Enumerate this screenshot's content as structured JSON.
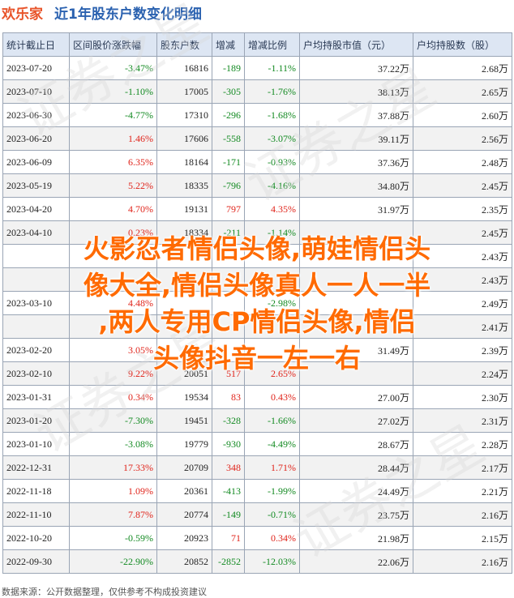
{
  "header": {
    "brand": "欢乐家",
    "title": "近1年股东户数变化明细"
  },
  "table": {
    "columns": [
      "统计截止日",
      "区间股价涨跌幅",
      "股东户数",
      "增减",
      "增减比例",
      "户均持股市值（元）",
      "户均持股数（股）"
    ],
    "rows": [
      {
        "date": "2023-07-20",
        "chg": "-3.47%",
        "holders": "16816",
        "delta": "-189",
        "ratio": "-1.11%",
        "value": "37.22万",
        "shares": "2.68万"
      },
      {
        "date": "2023-07-10",
        "chg": "-1.10%",
        "holders": "17005",
        "delta": "-305",
        "ratio": "-1.76%",
        "value": "38.13万",
        "shares": "2.65万"
      },
      {
        "date": "2023-06-30",
        "chg": "-4.77%",
        "holders": "17310",
        "delta": "-296",
        "ratio": "-1.68%",
        "value": "37.88万",
        "shares": "2.60万"
      },
      {
        "date": "2023-06-20",
        "chg": "1.46%",
        "holders": "17606",
        "delta": "-558",
        "ratio": "-3.07%",
        "value": "39.11万",
        "shares": "2.56万"
      },
      {
        "date": "2023-06-09",
        "chg": "6.35%",
        "holders": "18164",
        "delta": "-171",
        "ratio": "-0.93%",
        "value": "37.36万",
        "shares": "2.48万"
      },
      {
        "date": "2023-05-19",
        "chg": "5.22%",
        "holders": "18335",
        "delta": "-796",
        "ratio": "-4.16%",
        "value": "34.80万",
        "shares": "2.45万"
      },
      {
        "date": "2023-04-20",
        "chg": "4.70%",
        "holders": "19131",
        "delta": "797",
        "ratio": "4.35%",
        "value": "31.97万",
        "shares": "2.35万"
      },
      {
        "date": "2023-04-10",
        "chg": "0.23%",
        "holders": "18334",
        "delta": "-211",
        "ratio": "-1.14%",
        "value": "",
        "shares": "2.45万"
      },
      {
        "date": "",
        "chg": "",
        "holders": "",
        "delta": "",
        "ratio": "",
        "value": "",
        "shares": "2.43万"
      },
      {
        "date": "",
        "chg": "",
        "holders": "",
        "delta": "",
        "ratio": "",
        "value": "",
        "shares": "2.43万"
      },
      {
        "date": "2023-03-10",
        "chg": "4.48%",
        "holders": "",
        "delta": "",
        "ratio": "-2.98%",
        "value": "",
        "shares": "2.49万"
      },
      {
        "date": "",
        "chg": "",
        "holders": "",
        "delta": "",
        "ratio": "",
        "value": "",
        "shares": "2.41万"
      },
      {
        "date": "2023-02-20",
        "chg": "3.05%",
        "holders": "",
        "delta": "",
        "ratio": "",
        "value": "31.49万",
        "shares": "2.39万"
      },
      {
        "date": "2023-02-10",
        "chg": "9.22%",
        "holders": "20051",
        "delta": "517",
        "ratio": "2.65%",
        "value": "",
        "shares": "2.24万"
      },
      {
        "date": "2023-01-31",
        "chg": "0.34%",
        "holders": "19534",
        "delta": "83",
        "ratio": "0.43%",
        "value": "27.00万",
        "shares": "2.30万"
      },
      {
        "date": "2023-01-20",
        "chg": "-7.30%",
        "holders": "19451",
        "delta": "-328",
        "ratio": "-1.66%",
        "value": "27.02万",
        "shares": "2.31万"
      },
      {
        "date": "2023-01-10",
        "chg": "-3.08%",
        "holders": "19779",
        "delta": "-930",
        "ratio": "-4.49%",
        "value": "28.67万",
        "shares": "2.28万"
      },
      {
        "date": "2022-12-31",
        "chg": "17.33%",
        "holders": "20709",
        "delta": "348",
        "ratio": "1.71%",
        "value": "28.44万",
        "shares": "2.17万"
      },
      {
        "date": "2022-11-18",
        "chg": "1.09%",
        "holders": "20361",
        "delta": "-413",
        "ratio": "-1.99%",
        "value": "24.49万",
        "shares": "2.21万"
      },
      {
        "date": "2022-11-10",
        "chg": "7.87%",
        "holders": "20774",
        "delta": "-149",
        "ratio": "-0.71%",
        "value": "23.75万",
        "shares": "2.16万"
      },
      {
        "date": "2022-10-20",
        "chg": "-0.59%",
        "holders": "20923",
        "delta": "71",
        "ratio": "0.34%",
        "value": "21.98万",
        "shares": "2.15万"
      },
      {
        "date": "2022-09-30",
        "chg": "-22.90%",
        "holders": "20852",
        "delta": "-2852",
        "ratio": "-12.03%",
        "value": "22.06万",
        "shares": "2.16万"
      }
    ]
  },
  "overlay": {
    "lines": [
      "火影忍者情侣头像,萌娃情侣头",
      "像大全,情侣头像真人一人一半",
      ",两人专用CP情侣头像,情侣",
      "头像抖音一左一右"
    ]
  },
  "watermark": {
    "text": "证券之星"
  },
  "source": "数据来源：公开数据整理，仅供参考不构成投资建议",
  "colors": {
    "brand": "#e8542a",
    "title": "#2b62b0",
    "header_bg": "#dde6f3",
    "up": "#e0241b",
    "down": "#138a22",
    "overlay": "#ff6a00"
  }
}
